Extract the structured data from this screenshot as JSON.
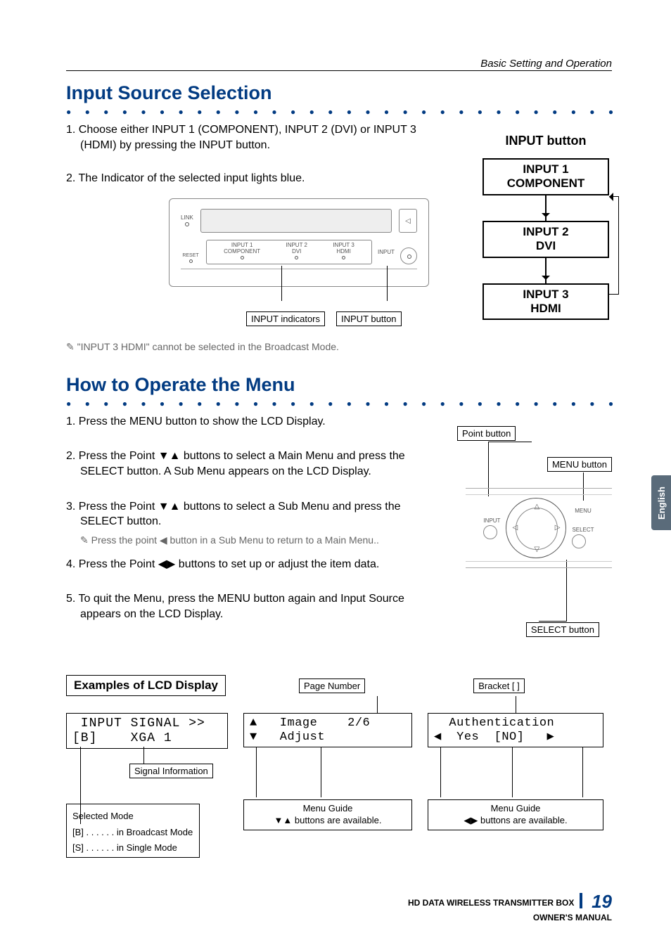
{
  "header": {
    "section_name": "Basic Setting and  Operation"
  },
  "lang_tab": "English",
  "section1": {
    "title": "Input Source Selection",
    "step1": "1. Choose either INPUT 1 (COMPONENT), INPUT 2 (DVI) or INPUT 3 (HDMI) by pressing the INPUT button.",
    "step2": "2.  The Indicator of the selected input lights blue.",
    "note": "\"INPUT 3 HDMI\" cannot be selected in the Broadcast Mode.",
    "panel": {
      "link": "LINK",
      "reset": "RESET",
      "in1_top": "INPUT 1",
      "in1_bot": "COMPONENT",
      "in2_top": "INPUT 2",
      "in2_bot": "DVI",
      "in3_top": "INPUT 3",
      "in3_bot": "HDMI",
      "input_lbl": "INPUT",
      "callout_indicators": "INPUT indicators",
      "callout_button": "INPUT button"
    },
    "right_col": {
      "heading": "INPUT button",
      "box1_l1": "INPUT 1",
      "box1_l2": "COMPONENT",
      "box2_l1": "INPUT 2",
      "box2_l2": "DVI",
      "box3_l1": "INPUT 3",
      "box3_l2": "HDMI"
    }
  },
  "section2": {
    "title": "How to Operate the Menu",
    "step1": "1. Press the MENU button to show the LCD Display.",
    "step2": "2. Press the Point ▼▲ buttons to select a Main Menu and press the SELECT button. A Sub Menu appears on the LCD Display.",
    "step3": "3. Press the Point ▼▲ buttons to select a Sub Menu and press the SELECT button.",
    "subnote": "Press the point ◀ button in a Sub Menu to return to a Main Menu..",
    "step4": "4. Press the Point ◀▶ buttons to set up or adjust the item data.",
    "step5": "5. To quit the Menu, press the MENU button again and Input Source appears on the LCD Display.",
    "diagram": {
      "point_btn": "Point button",
      "menu_btn": "MENU button",
      "select_btn": "SELECT button",
      "menu_lbl": "MENU",
      "select_lbl": "SELECT",
      "input_lbl": "INPUT"
    }
  },
  "examples": {
    "title": "Examples of LCD Display",
    "page_number_lbl": "Page Number",
    "bracket_lbl": "Bracket [  ]",
    "lcd1_l1": " INPUT SIGNAL >>",
    "lcd1_l2": "[B]    XGA 1",
    "lcd2_l1": "▲   Image    2/6",
    "lcd2_l2": "▼   Adjust",
    "lcd3_l1": "  Authentication",
    "lcd3_l2": "◀  Yes  [NO]   ▶",
    "signal_info": "Signal Information",
    "selected_mode": "Selected Mode",
    "mode_b": "[B] . . . . . . in Broadcast Mode",
    "mode_s": "[S] . . . . . . in Single Mode",
    "menu_guide": "Menu Guide",
    "guide_ud": "▼▲ buttons are available.",
    "guide_lr": "◀▶ buttons are available."
  },
  "footer": {
    "line1": "HD DATA WIRELESS TRANSMITTER BOX",
    "line2": "OWNER'S MANUAL",
    "page": "19"
  }
}
